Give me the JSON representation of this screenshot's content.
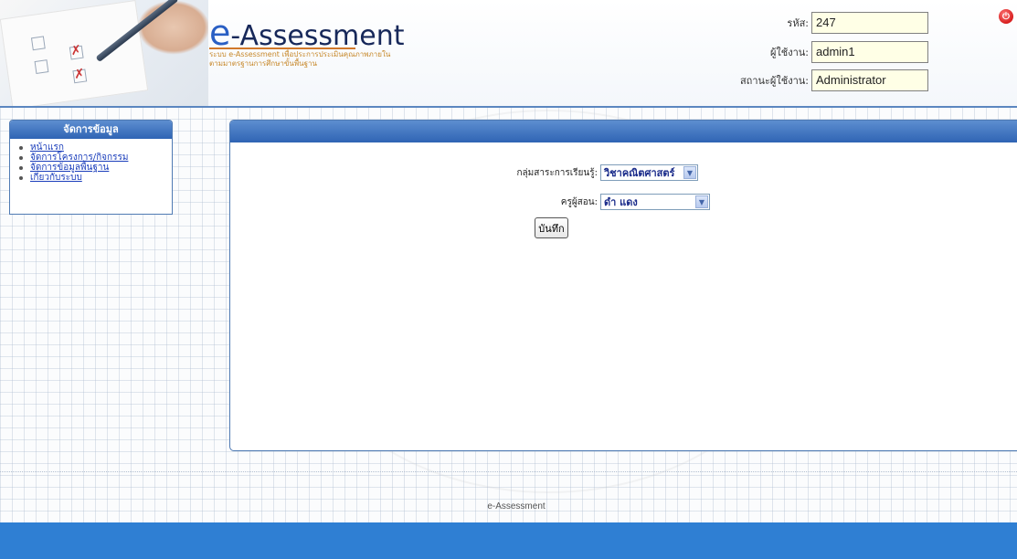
{
  "header": {
    "logo_title_e": "e",
    "logo_title_rest": "-Assessment",
    "logo_subtitle": "ระบบ e-Assessment เพื่อประการประเมินคุณภาพภายในตามมาตรฐานการศึกษาขั้นพื้นฐาน",
    "fields": [
      {
        "label": "รหัส:",
        "value": "247"
      },
      {
        "label": "ผู้ใช้งาน:",
        "value": "admin1"
      },
      {
        "label": "สถานะผู้ใช้งาน:",
        "value": "Administrator"
      }
    ],
    "power_icon": "power-icon"
  },
  "sidebar": {
    "title": "จัดการข้อมูล",
    "items": [
      {
        "label": "หน้าแรก"
      },
      {
        "label": "จัดการโครงการ/กิจกรรม"
      },
      {
        "label": "จัดการข้อมูลพื้นฐาน"
      },
      {
        "label": "เกี่ยวกับระบบ"
      }
    ]
  },
  "main": {
    "subject_label": "กลุ่มสาระการเรียนรู้:",
    "subject_value": "วิชาคณิตศาสตร์",
    "teacher_label": "ครูผู้สอน:",
    "teacher_value": "ดำ แดง",
    "save_label": "บันทึก"
  },
  "footer": {
    "text": "e-Assessment"
  },
  "colors": {
    "accent": "#2f64b4",
    "footer_bar": "#2f7fd3",
    "link": "#1a3dbb"
  }
}
